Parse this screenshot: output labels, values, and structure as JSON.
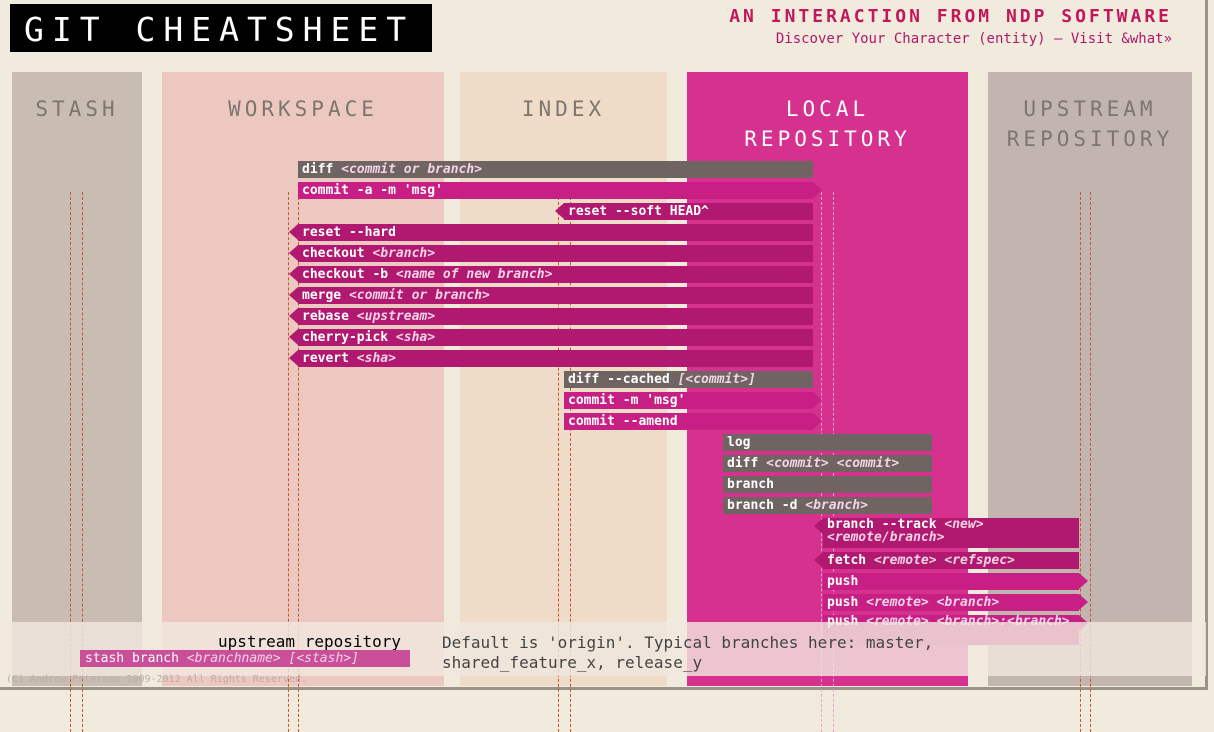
{
  "header": {
    "title": "GIT CHEATSHEET",
    "tagline": "AN INTERACTION FROM NDP SOFTWARE",
    "subline": "Discover Your Character (entity) — Visit &what»"
  },
  "columns": {
    "stash": "STASH",
    "workspace": "WORKSPACE",
    "index": "INDEX",
    "local": "LOCAL REPOSITORY",
    "upstream": "UPSTREAM REPOSITORY"
  },
  "commands": [
    {
      "cmd": "diff",
      "args": "<commit or branch>",
      "tail": ""
    },
    {
      "cmd": "commit -a -m 'msg'",
      "args": "",
      "tail": ""
    },
    {
      "cmd": "reset --soft HEAD^",
      "args": "",
      "tail": ""
    },
    {
      "cmd": "reset --hard",
      "args": "",
      "tail": ""
    },
    {
      "cmd": "checkout",
      "args": "<branch>",
      "tail": ""
    },
    {
      "cmd": "checkout -b",
      "args": "<name of new branch>",
      "tail": ""
    },
    {
      "cmd": "merge",
      "args": "<commit or branch>",
      "tail": ""
    },
    {
      "cmd": "rebase",
      "args": "<upstream>",
      "tail": ""
    },
    {
      "cmd": "cherry-pick",
      "args": "<sha>",
      "tail": ""
    },
    {
      "cmd": "revert",
      "args": "<sha>",
      "tail": ""
    },
    {
      "cmd": "diff --cached",
      "args": "[<commit>]",
      "tail": ""
    },
    {
      "cmd": "commit -m 'msg'",
      "args": "",
      "tail": ""
    },
    {
      "cmd": "commit --amend",
      "args": "",
      "tail": ""
    },
    {
      "cmd": "log",
      "args": "",
      "tail": ""
    },
    {
      "cmd": "diff",
      "args": "<commit> <commit>",
      "tail": ""
    },
    {
      "cmd": "branch",
      "args": "",
      "tail": ""
    },
    {
      "cmd": "branch -d",
      "args": "<branch>",
      "tail": ""
    },
    {
      "cmd": "branch --track",
      "args": "<new> <remote/branch>",
      "tail": ""
    },
    {
      "cmd": "fetch",
      "args": "<remote> <refspec>",
      "tail": ""
    },
    {
      "cmd": "push",
      "args": "",
      "tail": ""
    },
    {
      "cmd": "push",
      "args": "<remote> <branch>",
      "tail": ""
    },
    {
      "cmd": "push",
      "args": "<remote> <branch>:<branch>",
      "tail": ""
    }
  ],
  "info": {
    "term": "upstream repository",
    "definition": "Default is 'origin'. Typical branches here: master, shared_feature_x, release_y"
  },
  "stash_cmd": {
    "cmd": "stash branch",
    "args": "<branchname> [<stash>]"
  },
  "copyright": "(C) Andrew Peterson 2009-2012 All Rights Reserved.",
  "colors": {
    "accent": "#c2185b",
    "local_column": "#d6318f",
    "command_magenta": "#b0196f",
    "command_gray": "#6f6462"
  }
}
